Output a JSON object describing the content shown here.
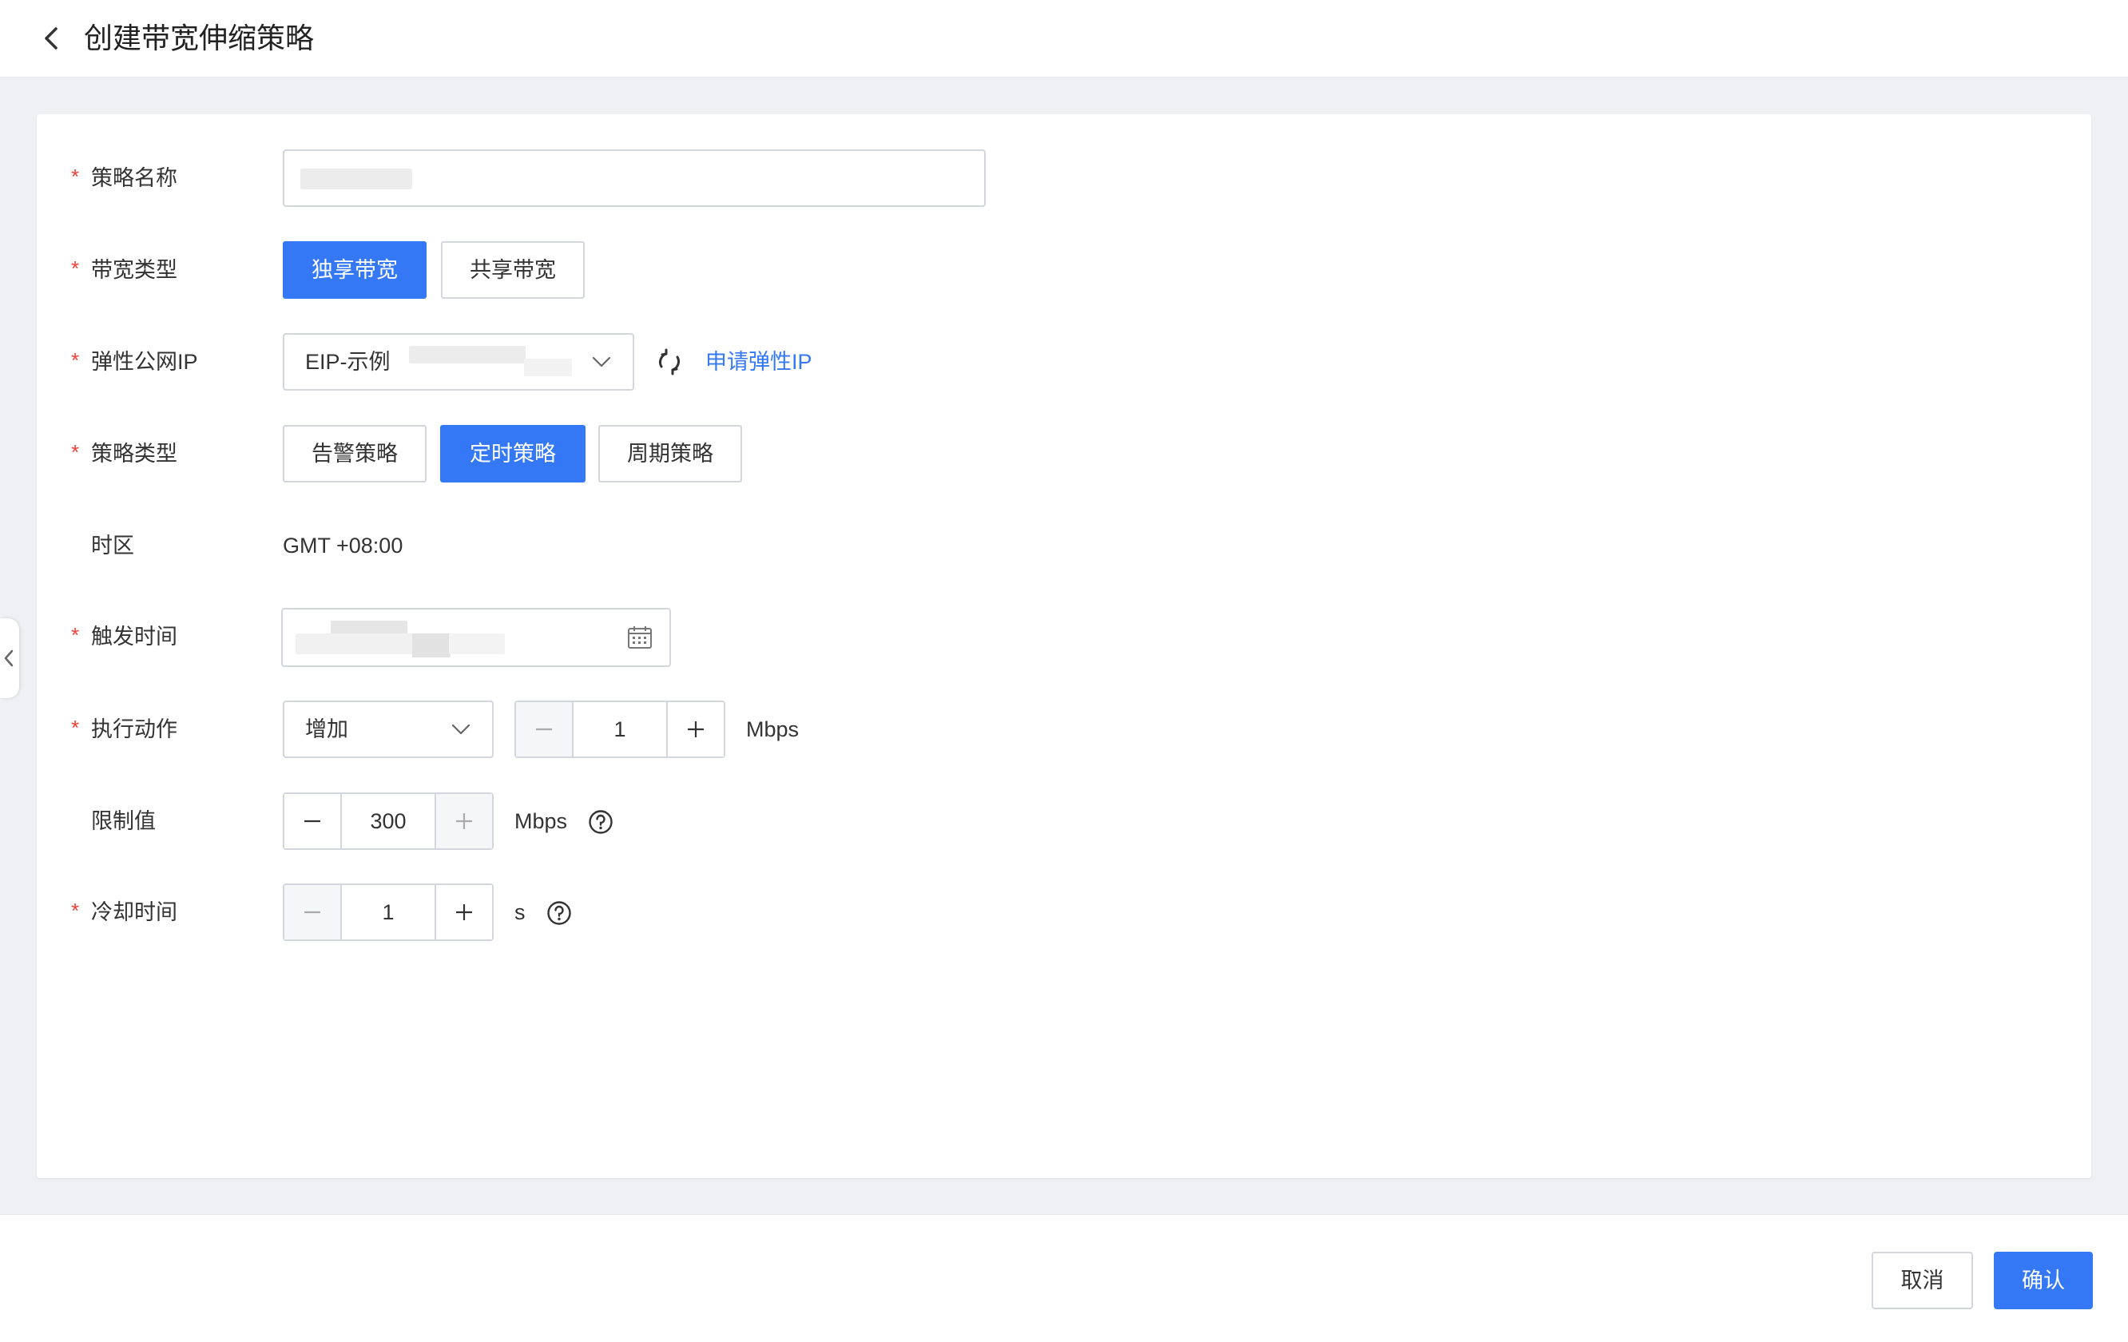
{
  "header": {
    "title": "创建带宽伸缩策略",
    "back_icon": "chevron-left-icon"
  },
  "form": {
    "required_mark": "*",
    "policy_name": {
      "label": "策略名称",
      "value": ""
    },
    "bandwidth_type": {
      "label": "带宽类型",
      "options": [
        "独享带宽",
        "共享带宽"
      ],
      "selected": "独享带宽"
    },
    "eip": {
      "label": "弹性公网IP",
      "value": "EIP-示例",
      "apply_link": "申请弹性IP",
      "refresh_icon": "refresh-icon"
    },
    "policy_type": {
      "label": "策略类型",
      "options": [
        "告警策略",
        "定时策略",
        "周期策略"
      ],
      "selected": "定时策略"
    },
    "timezone": {
      "label": "时区",
      "value": "GMT +08:00"
    },
    "trigger_time": {
      "label": "触发时间",
      "icon": "calendar-icon"
    },
    "action": {
      "label": "执行动作",
      "select_value": "增加",
      "amount": "1",
      "unit": "Mbps"
    },
    "limit": {
      "label": "限制值",
      "value": "300",
      "unit": "Mbps"
    },
    "cooldown": {
      "label": "冷却时间",
      "value": "1",
      "unit": "s"
    }
  },
  "footer": {
    "cancel_label": "取消",
    "confirm_label": "确认"
  },
  "colors": {
    "primary": "#3478f6",
    "required": "#f04134",
    "border": "#d3d6dc",
    "page_bg": "#eef0f4"
  }
}
